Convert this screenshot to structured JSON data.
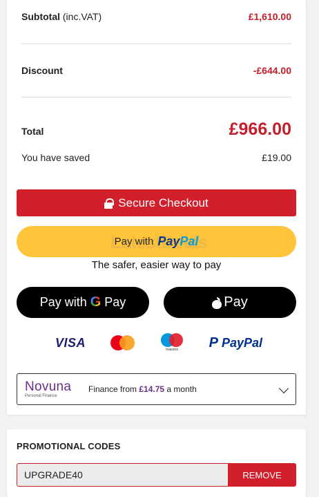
{
  "summary": {
    "subtotal_label": "Subtotal",
    "subtotal_suffix": " (inc.VAT)",
    "subtotal_value": "£1,610.00",
    "discount_label": "Discount",
    "discount_value": "-£644.00",
    "total_label": "Total",
    "total_value": "£966.00",
    "saved_label": "You have saved",
    "saved_value": "£19.00"
  },
  "checkout": {
    "secure_label": "Secure Checkout",
    "paypal_with": "Pay with",
    "paypal_brand_1": "Pay",
    "paypal_brand_2": "Pal",
    "paypal_tagline": "The safer, easier way to pay",
    "gpay_with": "Pay with",
    "gpay_g": "G",
    "gpay_pay": "Pay",
    "applepay_label": "Pay"
  },
  "watermark": "LatestDeals",
  "payment_icons": {
    "visa": "VISA",
    "maestro_text": "maestro",
    "paypal": "PayPal",
    "paypal_glyph": "P"
  },
  "finance": {
    "brand": "Novuna",
    "brand_sub": "Personal Finance",
    "text_prefix": "Finance from ",
    "amount": "£14.75",
    "text_suffix": " a month"
  },
  "promo": {
    "title": "PROMOTIONAL CODES",
    "code_value": "UPGRADE40",
    "remove_label": "REMOVE"
  },
  "colors": {
    "accent_red": "#d11f2b",
    "paypal_yellow": "#ffc439",
    "novuna_purple": "#6a2c8c"
  }
}
